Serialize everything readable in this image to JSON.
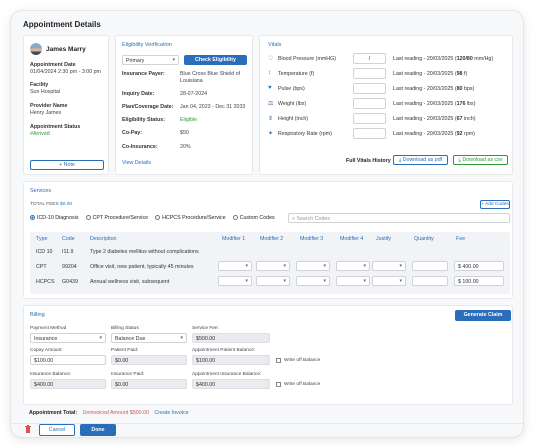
{
  "page": {
    "title": "Appointment Details"
  },
  "patient": {
    "name": "James Marry",
    "appointment_date_label": "Appointment Date",
    "appointment_date_value": "01/04/2024  2:30 pm - 3:00 pm",
    "facility_label": "Facility",
    "facility_value": "Sun Hospital",
    "provider_label": "Provider Name",
    "provider_value": "Henry James",
    "status_label": "Appointment Status",
    "status_value": "#Arrived",
    "note_button": "+ Note"
  },
  "eligibility": {
    "title": "Eligibility Verification",
    "select_value": "Primary",
    "check_button": "Check Eligibility",
    "insurance_payer_label": "Insurance Payer:",
    "insurance_payer_value": "Blue Cross Blue Shield of Louisiana",
    "inquiry_date_label": "Inquiry Date:",
    "inquiry_date_value": "28-07-2024",
    "plan_coverage_label": "Plan/Coverage Date:",
    "plan_coverage_value": "Jan 04, 2023 - Dec 31 2033",
    "status_label": "Eligibility Status:",
    "status_value": "Eligible",
    "copay_label": "Co-Pay:",
    "copay_value": "$50",
    "coinsurance_label": "Co-Insurance:",
    "coinsurance_value": "20%",
    "view_details": "View Details"
  },
  "vitals": {
    "title": "Vitals",
    "items": [
      {
        "icon": "heart-icon",
        "label": "Blood Pressure (mmHG)",
        "value": "/",
        "reading_prefix": "Last reading - 20/03/2025 (",
        "reading_value": "120/80",
        "reading_suffix": " mm/Hg)"
      },
      {
        "icon": "thermometer-icon",
        "label": "Temperature (f)",
        "value": "",
        "reading_prefix": "Last reading - 20/03/2025 (",
        "reading_value": "98",
        "reading_suffix": " f)"
      },
      {
        "icon": "pulse-icon",
        "label": "Pulse (bps)",
        "value": "",
        "reading_prefix": "Last reading - 20/03/2025 (",
        "reading_value": "80",
        "reading_suffix": " bps)"
      },
      {
        "icon": "scale-icon",
        "label": "Weight (lbs)",
        "value": "",
        "reading_prefix": "Last reading - 20/03/2025 (",
        "reading_value": "176",
        "reading_suffix": " lbs)"
      },
      {
        "icon": "height-icon",
        "label": "Height (inch)",
        "value": "",
        "reading_prefix": "Last reading - 20/03/2025 (",
        "reading_value": "67",
        "reading_suffix": " inch)"
      },
      {
        "icon": "lungs-icon",
        "label": "Respiratory Rate (rpm)",
        "value": "",
        "reading_prefix": "Last reading - 20/03/2025 (",
        "reading_value": "92",
        "reading_suffix": " rpm)"
      }
    ],
    "history_label": "Full Vitals History",
    "download_pdf": "Download as pdf",
    "download_csv": "Download as csv"
  },
  "services": {
    "title": "Services",
    "total_fees_label": "TOTAL FEES",
    "total_fees_value": "$0.00",
    "add_codes": "+ Add Codes",
    "radio_options": [
      {
        "label": "ICD-10 Diagnosis",
        "selected": true
      },
      {
        "label": "CPT Procedure/Service",
        "selected": false
      },
      {
        "label": "HCPCS Procedure/Service",
        "selected": false
      },
      {
        "label": "Custom Codes",
        "selected": false
      }
    ],
    "search_placeholder": "Search Codes",
    "columns": [
      "Type",
      "Code",
      "Description",
      "Modifier 1",
      "Modifier 2",
      "Modifier 3",
      "Modifier 4",
      "Justify",
      "Quantity",
      "Fee"
    ],
    "rows": [
      {
        "type": "ICD 10",
        "code": "I11.9",
        "description": "Type 2 diabetes mellitus without complications",
        "fee": ""
      },
      {
        "type": "CPT",
        "code": "99204",
        "description": "Office visit, new patient, typically 45 minutes",
        "fee": "$ 400.00"
      },
      {
        "type": "HCPCS",
        "code": "G0439",
        "description": "Annual wellness visit, subsequent",
        "fee": "$ 100.00"
      }
    ]
  },
  "billing": {
    "title": "Billing",
    "generate_claim": "Generate Claim",
    "payment_method_label": "Payment Method",
    "payment_method_value": "Insurance",
    "billing_status_label": "Billing Status",
    "billing_status_value": "Balance Due",
    "service_fee_label": "Service Fee:",
    "service_fee_value": "$500.00",
    "copay_amount_label": "Copay Amount:",
    "copay_amount_value": "$100.00",
    "patient_paid_label": "Patient Paid:",
    "patient_paid_value": "$0.00",
    "appt_patient_balance_label": "Appointment Patient Balance:",
    "appt_patient_balance_value": "$100.00",
    "write_off_balance": "Write off Balance",
    "insurance_balance_label": "Insurance Balance:",
    "insurance_balance_value": "$400.00",
    "insurance_paid_label": "Insurance Paid:",
    "insurance_paid_value": "$0.00",
    "appt_insurance_balance_label": "Appointment Insurance Balance:",
    "appt_insurance_balance_value": "$400.00",
    "write_off_balance_2": "Write off Balance"
  },
  "footer": {
    "appointment_total_label": "Appointment Total:",
    "unrevoiced_amount": "Uninvoiced Amount $500.00",
    "create_invoice": "Create Invoice",
    "cancel": "Cancel",
    "done": "Done"
  },
  "colors": {
    "accent": "#2a6ebb",
    "success": "#2e9a3a",
    "danger": "#d9534f"
  }
}
